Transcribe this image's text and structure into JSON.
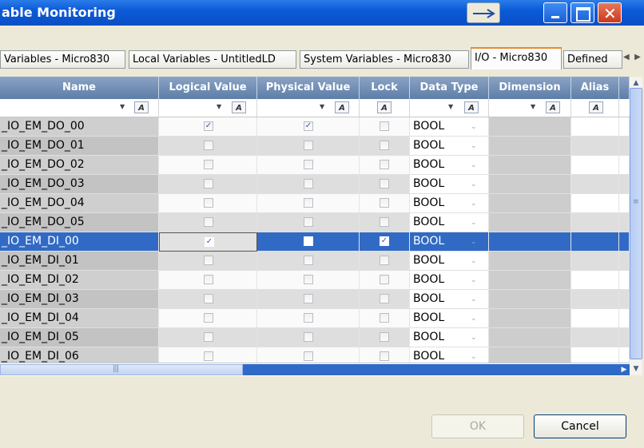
{
  "window": {
    "title": "able Monitoring"
  },
  "tabs": [
    {
      "label": "Variables - Micro830"
    },
    {
      "label": "Local Variables - UntitledLD"
    },
    {
      "label": "System Variables - Micro830"
    },
    {
      "label": "I/O - Micro830"
    },
    {
      "label": "Defined"
    }
  ],
  "active_tab": "I/O - Micro830",
  "columns": [
    "Name",
    "Logical Value",
    "Physical Value",
    "Lock",
    "Data Type",
    "Dimension",
    "Alias"
  ],
  "filter_icon": "filter-icon",
  "rows": [
    {
      "name": "_IO_EM_DO_00",
      "logical": true,
      "physical": true,
      "lock": false,
      "type": "BOOL"
    },
    {
      "name": "_IO_EM_DO_01",
      "logical": false,
      "physical": false,
      "lock": false,
      "type": "BOOL"
    },
    {
      "name": "_IO_EM_DO_02",
      "logical": false,
      "physical": false,
      "lock": false,
      "type": "BOOL"
    },
    {
      "name": "_IO_EM_DO_03",
      "logical": false,
      "physical": false,
      "lock": false,
      "type": "BOOL"
    },
    {
      "name": "_IO_EM_DO_04",
      "logical": false,
      "physical": false,
      "lock": false,
      "type": "BOOL"
    },
    {
      "name": "_IO_EM_DO_05",
      "logical": false,
      "physical": false,
      "lock": false,
      "type": "BOOL"
    },
    {
      "name": "_IO_EM_DI_00",
      "logical": true,
      "physical": false,
      "lock": true,
      "type": "BOOL",
      "selected": true
    },
    {
      "name": "_IO_EM_DI_01",
      "logical": false,
      "physical": false,
      "lock": false,
      "type": "BOOL"
    },
    {
      "name": "_IO_EM_DI_02",
      "logical": false,
      "physical": false,
      "lock": false,
      "type": "BOOL"
    },
    {
      "name": "_IO_EM_DI_03",
      "logical": false,
      "physical": false,
      "lock": false,
      "type": "BOOL"
    },
    {
      "name": "_IO_EM_DI_04",
      "logical": false,
      "physical": false,
      "lock": false,
      "type": "BOOL"
    },
    {
      "name": "_IO_EM_DI_05",
      "logical": false,
      "physical": false,
      "lock": false,
      "type": "BOOL"
    },
    {
      "name": "_IO_EM_DI_06",
      "logical": false,
      "physical": false,
      "lock": false,
      "type": "BOOL"
    }
  ],
  "buttons": {
    "ok": "OK",
    "cancel": "Cancel"
  },
  "colors": {
    "title_bar": "#0a4fc4",
    "selection": "#316ac5",
    "header": "#6f8cb5"
  }
}
